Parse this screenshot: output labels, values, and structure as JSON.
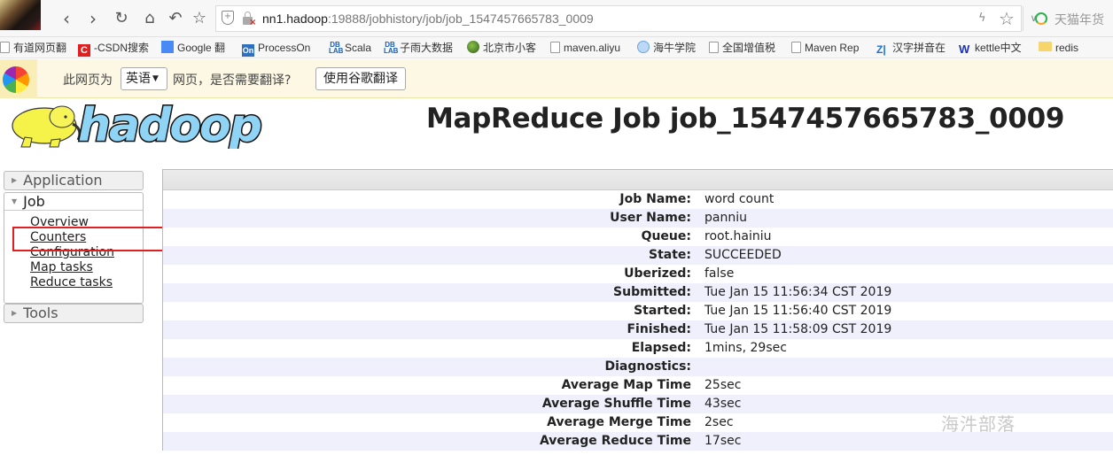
{
  "browser": {
    "url_host": "nn1.hadoop",
    "url_rest": ":19888/jobhistory/job/job_1547457665783_0009",
    "search_hint": "天猫年货"
  },
  "bookmarks": [
    {
      "label": "有道网页翻",
      "icon": "page-icon"
    },
    {
      "label": "-CSDN搜索",
      "icon": "csdn-icon"
    },
    {
      "label": "Google 翻",
      "icon": "google-translate-icon"
    },
    {
      "label": "ProcessOn",
      "icon": "processon-icon"
    },
    {
      "label": "Scala",
      "icon": "dblab-icon"
    },
    {
      "label": "子雨大数据",
      "icon": "dblab-icon"
    },
    {
      "label": "北京市小客",
      "icon": "globe-icon"
    },
    {
      "label": "maven.aliyu",
      "icon": "page-icon"
    },
    {
      "label": "海牛学院",
      "icon": "hainiu-icon"
    },
    {
      "label": "全国增值税",
      "icon": "page-icon"
    },
    {
      "label": "Maven Rep",
      "icon": "page-icon"
    },
    {
      "label": "汉字拼音在",
      "icon": "zj-icon"
    },
    {
      "label": "kettle中文",
      "icon": "w-icon"
    },
    {
      "label": "redis",
      "icon": "folder-icon"
    }
  ],
  "translate_bar": {
    "prefix": "此网页为",
    "language": "英语",
    "question": "网页，是否需要翻译?",
    "button": "使用谷歌翻译"
  },
  "header": {
    "logo_text": "hadoop",
    "title": "MapReduce Job job_1547457665783_0009"
  },
  "sidebar": {
    "application": "Application",
    "job": "Job",
    "job_links": [
      "Overview",
      "Counters",
      "Configuration",
      "Map tasks",
      "Reduce tasks"
    ],
    "tools": "Tools",
    "highlighted": "Counters"
  },
  "job_info": [
    {
      "key": "Job Name:",
      "value": "word count"
    },
    {
      "key": "User Name:",
      "value": "panniu"
    },
    {
      "key": "Queue:",
      "value": "root.hainiu"
    },
    {
      "key": "State:",
      "value": "SUCCEEDED"
    },
    {
      "key": "Uberized:",
      "value": "false"
    },
    {
      "key": "Submitted:",
      "value": "Tue Jan 15 11:56:34 CST 2019"
    },
    {
      "key": "Started:",
      "value": "Tue Jan 15 11:56:40 CST 2019"
    },
    {
      "key": "Finished:",
      "value": "Tue Jan 15 11:58:09 CST 2019"
    },
    {
      "key": "Elapsed:",
      "value": "1mins, 29sec"
    },
    {
      "key": "Diagnostics:",
      "value": ""
    },
    {
      "key": "Average Map Time",
      "value": "25sec"
    },
    {
      "key": "Average Shuffle Time",
      "value": "43sec"
    },
    {
      "key": "Average Merge Time",
      "value": "2sec"
    },
    {
      "key": "Average Reduce Time",
      "value": "17sec"
    }
  ],
  "watermark": "海汼部落"
}
